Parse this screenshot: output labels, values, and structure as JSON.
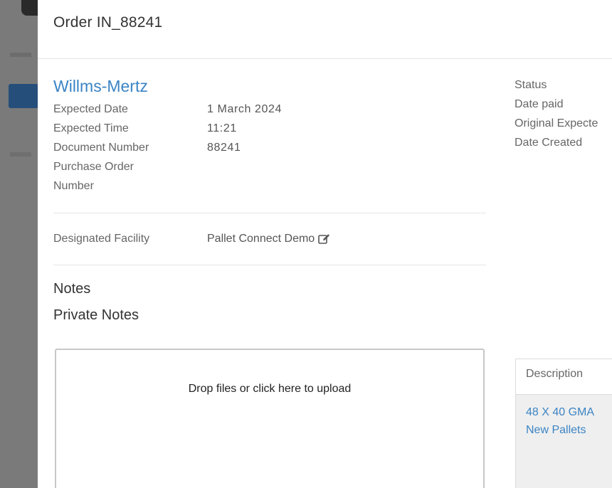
{
  "modal": {
    "title": "Order IN_88241"
  },
  "order": {
    "vendor": "Willms-Mertz",
    "fields": [
      {
        "label": "Expected Date",
        "value": "1 March 2024"
      },
      {
        "label": "Expected Time",
        "value": "11:21"
      },
      {
        "label": "Document Number",
        "value": "88241"
      },
      {
        "label": "Purchase Order Number",
        "value": ""
      }
    ],
    "facility": {
      "label": "Designated Facility",
      "value": "Pallet Connect Demo"
    }
  },
  "notes": {
    "heading": "Notes",
    "private_heading": "Private Notes",
    "upload_text": "Drop files or click here to upload"
  },
  "meta": {
    "status_label": "Status",
    "date_paid_label": "Date paid",
    "original_expected_label": "Original Expecte",
    "date_created_label": "Date Created"
  },
  "items_table": {
    "description_header": "Description",
    "rows": [
      {
        "description_line1": "48 X 40 GMA",
        "description_line2": "New Pallets"
      }
    ]
  },
  "colors": {
    "link": "#3b84c4",
    "backdrop": "#7a7a7a",
    "backdrop_button": "#254e7a"
  }
}
